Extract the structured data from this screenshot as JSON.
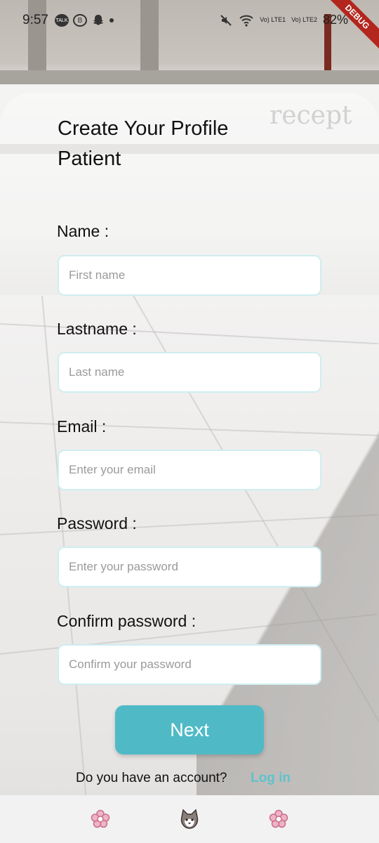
{
  "status_bar": {
    "time": "9:57",
    "battery": "82%",
    "network_1": "Vo) LTE1",
    "network_2": "Vo) LTE2",
    "badges": [
      "TALK",
      "B"
    ],
    "debug_label": "DEBUG"
  },
  "background": {
    "sign_text": "recept"
  },
  "form": {
    "title": "Create Your Profile Patient",
    "fields": [
      {
        "label": "Name :",
        "placeholder": "First name",
        "value": ""
      },
      {
        "label": "Lastname :",
        "placeholder": "Last name",
        "value": ""
      },
      {
        "label": "Email :",
        "placeholder": "Enter your email",
        "value": ""
      },
      {
        "label": "Password :",
        "placeholder": "Enter your password",
        "value": ""
      },
      {
        "label": "Confirm password :",
        "placeholder": "Confirm your password",
        "value": ""
      }
    ],
    "next_label": "Next",
    "account_question": "Do you have an account?",
    "login_label": "Log in"
  },
  "bottom_nav": {
    "items": [
      {
        "icon": "flower-icon"
      },
      {
        "icon": "cat-icon"
      },
      {
        "icon": "flower-icon"
      }
    ]
  },
  "colors": {
    "accent": "#4fbac6",
    "field_border": "#cfeef0",
    "flower_pink": "#e9a8bd",
    "debug_red": "#b3261e"
  }
}
